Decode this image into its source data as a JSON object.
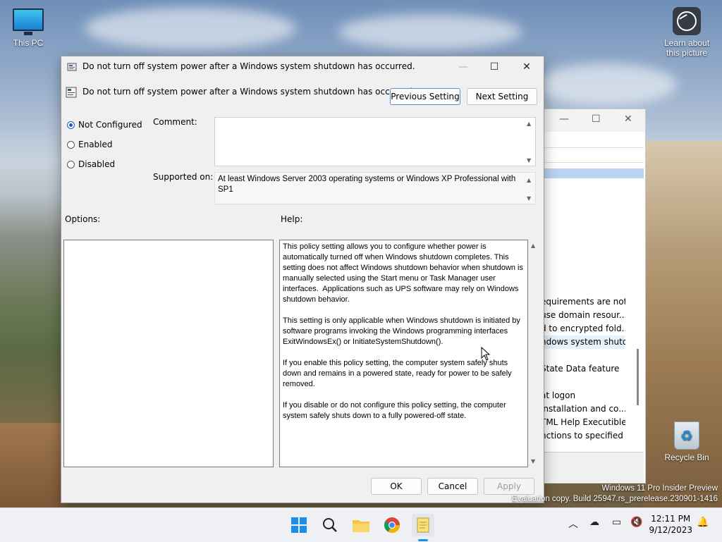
{
  "desktop": {
    "this_pc": "This PC",
    "learn_about": "Learn about this picture",
    "recycle_bin": "Recycle Bin"
  },
  "watermark": {
    "line1": "Windows 11 Pro Insider Preview",
    "line2": "Evaluation copy. Build 25947.rs_prerelease.230901-1416"
  },
  "background_window": {
    "rows": [
      "equirements are not...",
      "use domain resour...",
      "d to encrypted fold...",
      "ndows system shutd...",
      "",
      "State Data feature",
      "",
      "at logon",
      "installation and co...",
      "TML Help Executible",
      "nctions to specified"
    ]
  },
  "dialog": {
    "title": "Do not turn off system power after a Windows system shutdown has occurred.",
    "heading": "Do not turn off system power after a Windows system shutdown has occurred.",
    "prev_button": "Previous Setting",
    "next_button": "Next Setting",
    "radios": [
      {
        "label": "Not Configured",
        "selected": true
      },
      {
        "label": "Enabled",
        "selected": false
      },
      {
        "label": "Disabled",
        "selected": false
      }
    ],
    "comment_label": "Comment:",
    "comment_value": "",
    "supported_label": "Supported on:",
    "supported_value": "At least Windows Server 2003 operating systems or Windows XP Professional with SP1",
    "options_label": "Options:",
    "help_label": "Help:",
    "help_text": "This policy setting allows you to configure whether power is automatically turned off when Windows shutdown completes. This setting does not affect Windows shutdown behavior when shutdown is manually selected using the Start menu or Task Manager user interfaces.  Applications such as UPS software may rely on Windows shutdown behavior.\n\nThis setting is only applicable when Windows shutdown is initiated by software programs invoking the Windows programming interfaces ExitWindowsEx() or InitiateSystemShutdown().\n\nIf you enable this policy setting, the computer system safely shuts down and remains in a powered state, ready for power to be safely removed.\n\nIf you disable or do not configure this policy setting, the computer system safely shuts down to a fully powered-off state.",
    "ok_button": "OK",
    "cancel_button": "Cancel",
    "apply_button": "Apply"
  },
  "taskbar": {
    "time": "12:11 PM",
    "date": "9/12/2023",
    "icons": [
      "windows-start-icon",
      "search-icon",
      "file-explorer-icon",
      "chrome-icon",
      "notepad-icon"
    ]
  },
  "colors": {
    "accent": "#1a5fb4",
    "dialog_bg": "#f0f0f0",
    "taskbar_bg": "#eef0f3"
  }
}
